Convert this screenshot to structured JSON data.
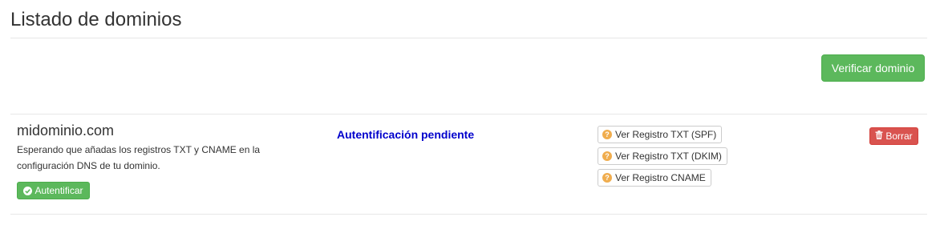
{
  "page": {
    "title": "Listado de dominios"
  },
  "toolbar": {
    "verify_label": "Verificar dominio"
  },
  "domain": {
    "name": "midominio.com",
    "description": "Esperando que añadas los registros TXT y CNAME en la configuración DNS de tu dominio.",
    "authenticate_label": "Autentificar",
    "status": "Autentificación pendiente",
    "status_color": "#0000cc",
    "records": [
      {
        "label": "Ver Registro TXT (SPF)",
        "icon": "question-circle-icon"
      },
      {
        "label": "Ver Registro TXT (DKIM)",
        "icon": "question-circle-icon"
      },
      {
        "label": "Ver Registro CNAME",
        "icon": "question-circle-icon"
      }
    ],
    "delete_label": "Borrar"
  },
  "colors": {
    "success": "#5cb85c",
    "danger": "#d9534f",
    "warning": "#f0ad4e"
  }
}
